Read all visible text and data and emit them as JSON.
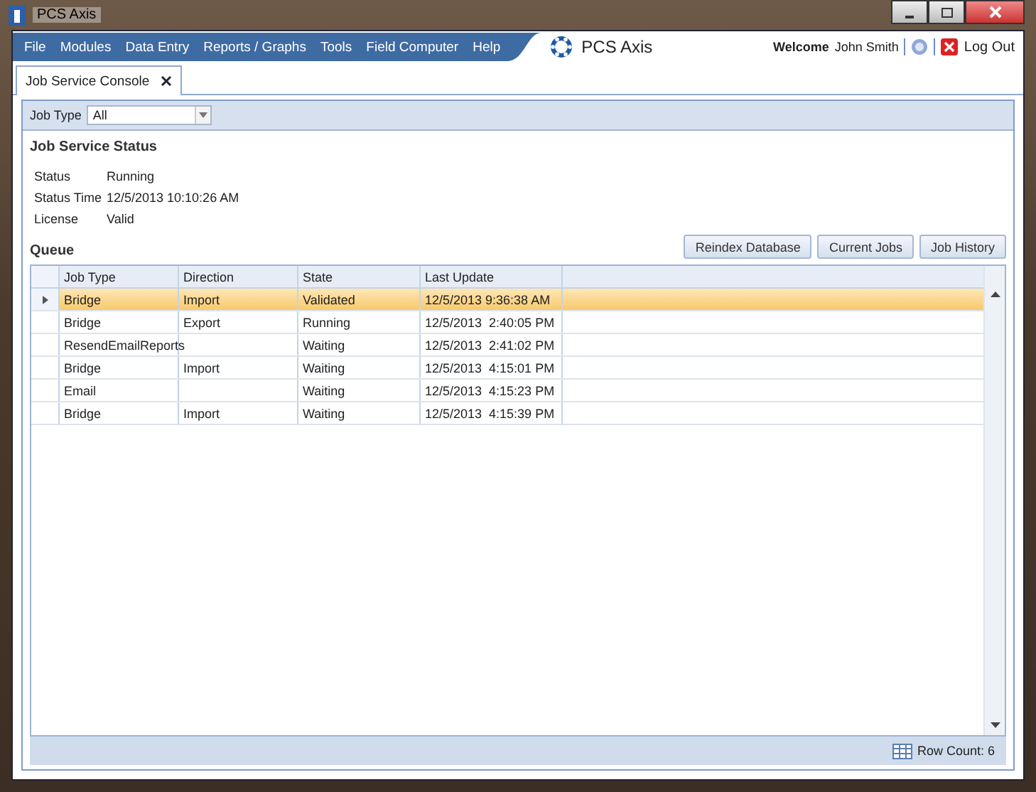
{
  "window": {
    "title": "PCS Axis"
  },
  "menu": [
    "File",
    "Modules",
    "Data Entry",
    "Reports / Graphs",
    "Tools",
    "Field Computer",
    "Help"
  ],
  "brand": "PCS Axis",
  "user": {
    "welcome": "Welcome",
    "name": "John Smith",
    "logout": "Log Out"
  },
  "tabs": [
    {
      "label": "Job Service Console",
      "selected": true
    }
  ],
  "filter": {
    "label": "Job Type",
    "value": "All"
  },
  "status_section": {
    "title": "Job Service Status",
    "fields": [
      {
        "label": "Status",
        "value": "Running"
      },
      {
        "label": "Status Time",
        "value": "12/5/2013 10:10:26 AM"
      },
      {
        "label": "License",
        "value": "Valid"
      }
    ]
  },
  "queue": {
    "title": "Queue",
    "buttons": [
      "Reindex Database",
      "Current Jobs",
      "Job History"
    ]
  },
  "table": {
    "columns": [
      "Job Type",
      "Direction",
      "State",
      "Last Update"
    ],
    "rows": [
      {
        "cells": [
          "Bridge",
          "Import",
          "Validated",
          "12/5/2013 9:36:38 AM"
        ],
        "selected": true
      },
      {
        "cells": [
          "Bridge",
          "Export",
          "Running",
          "12/5/2013  2:40:05 PM"
        ],
        "selected": false
      },
      {
        "cells": [
          "ResendEmailReports",
          "",
          "Waiting",
          "12/5/2013  2:41:02 PM"
        ],
        "selected": false
      },
      {
        "cells": [
          "Bridge",
          "Import",
          "Waiting",
          "12/5/2013  4:15:01 PM"
        ],
        "selected": false
      },
      {
        "cells": [
          "Email",
          "",
          "Waiting",
          "12/5/2013  4:15:23 PM"
        ],
        "selected": false
      },
      {
        "cells": [
          "Bridge",
          "Import",
          "Waiting",
          "12/5/2013  4:15:39 PM"
        ],
        "selected": false
      }
    ]
  },
  "status_bar": {
    "row_count": "Row Count: 6"
  }
}
